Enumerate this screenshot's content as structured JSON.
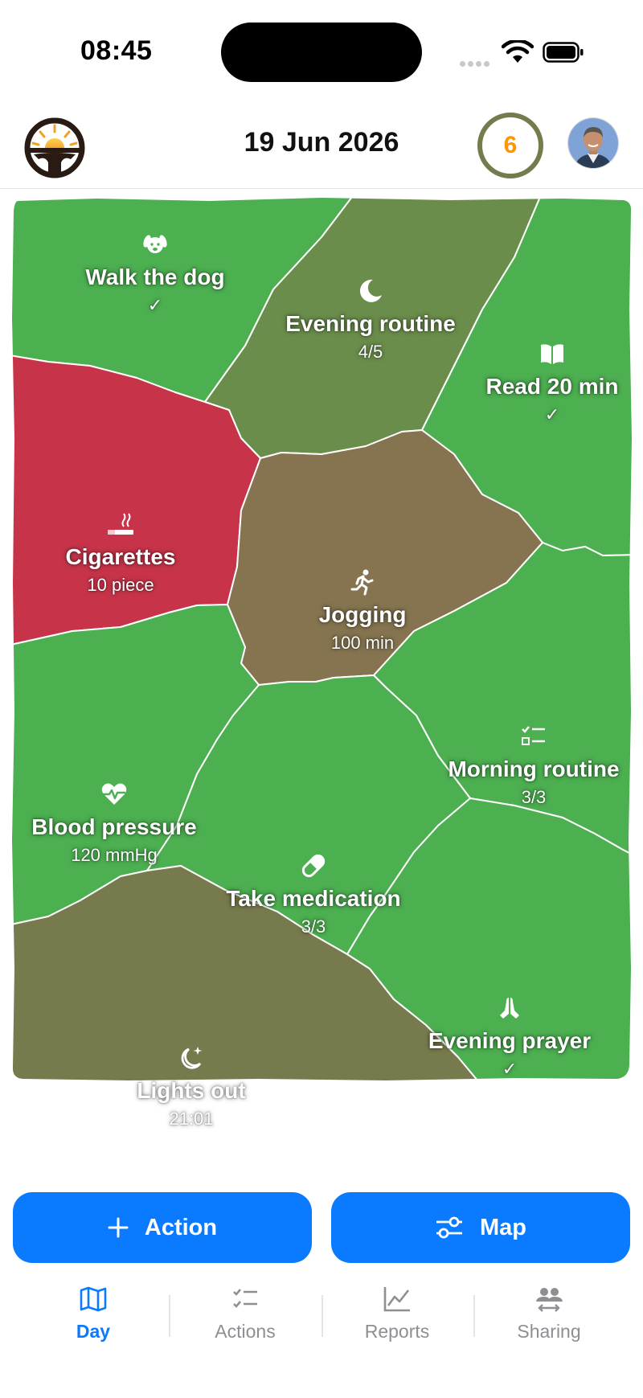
{
  "status_bar": {
    "time": "08:45"
  },
  "header": {
    "date": "19 Jun 2026",
    "streak_count": "6",
    "streak_ring_color": "#747b4c",
    "streak_text_color": "#ff9500"
  },
  "colors": {
    "green": "#4caf50",
    "olive": "#6a8d4b",
    "brown": "#85744f",
    "red": "#c7344a",
    "dark_olive": "#777a4c",
    "accent": "#0a7aff"
  },
  "cells": [
    {
      "id": "walk-dog",
      "title": "Walk the dog",
      "value": "✓",
      "icon": "dog-icon",
      "color": "#4caf50"
    },
    {
      "id": "evening-routine",
      "title": "Evening routine",
      "value": "4/5",
      "icon": "moon-icon",
      "color": "#6a8d4b"
    },
    {
      "id": "read",
      "title": "Read 20 min",
      "value": "✓",
      "icon": "book-icon",
      "color": "#4caf50"
    },
    {
      "id": "cigarettes",
      "title": "Cigarettes",
      "value": "10 piece",
      "icon": "cigarette-icon",
      "color": "#c7344a"
    },
    {
      "id": "jogging",
      "title": "Jogging",
      "value": "100 min",
      "icon": "runner-icon",
      "color": "#85744f"
    },
    {
      "id": "morning-routine",
      "title": "Morning routine",
      "value": "3/3",
      "icon": "checklist-icon",
      "color": "#4caf50"
    },
    {
      "id": "blood-pressure",
      "title": "Blood pressure",
      "value": "120 mmHg",
      "icon": "heart-pulse-icon",
      "color": "#4caf50"
    },
    {
      "id": "medication",
      "title": "Take medication",
      "value": "3/3",
      "icon": "pill-icon",
      "color": "#4caf50"
    },
    {
      "id": "lights-out",
      "title": "Lights out",
      "value": "21:01",
      "icon": "moon-stars-icon",
      "color": "#777a4c"
    },
    {
      "id": "evening-prayer",
      "title": "Evening prayer",
      "value": "✓",
      "icon": "praying-hands-icon",
      "color": "#4caf50"
    }
  ],
  "buttons": {
    "action": "Action",
    "map": "Map"
  },
  "tabs": [
    {
      "label": "Day",
      "icon": "map-icon",
      "active": true
    },
    {
      "label": "Actions",
      "icon": "checklist-icon",
      "active": false
    },
    {
      "label": "Reports",
      "icon": "chart-icon",
      "active": false
    },
    {
      "label": "Sharing",
      "icon": "people-icon",
      "active": false
    }
  ]
}
